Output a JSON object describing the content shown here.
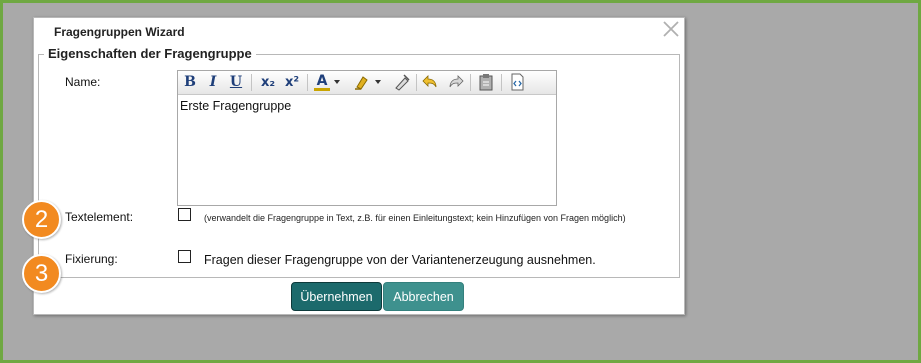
{
  "dialog": {
    "title": "Fragengruppen Wizard",
    "close_icon": "close-icon"
  },
  "fieldset": {
    "legend": "Eigenschaften der Fragengruppe"
  },
  "name_field": {
    "label": "Name:",
    "value": "Erste Fragengruppe"
  },
  "toolbar": {
    "bold": "B",
    "italic": "I",
    "underline": "U",
    "subscript": "x₂",
    "superscript": "x²",
    "font_color": "A",
    "icons": [
      "bold-icon",
      "italic-icon",
      "underline-icon",
      "subscript-icon",
      "superscript-icon",
      "font-color-icon",
      "highlight-icon",
      "clear-format-icon",
      "undo-icon",
      "redo-icon",
      "paste-icon",
      "source-icon"
    ]
  },
  "textelement": {
    "label": "Textelement:",
    "checked": false,
    "hint": "(verwandelt die Fragengruppe in Text, z.B. für einen Einleitungstext; kein Hinzufügen von Fragen möglich)"
  },
  "fixierung": {
    "label": "Fixierung:",
    "checked": false,
    "text": "Fragen dieser Fragengruppe von der Variantenerzeugung ausnehmen."
  },
  "buttons": {
    "apply": "Übernehmen",
    "cancel": "Abbrechen"
  },
  "badges": [
    "2",
    "3"
  ],
  "colors": {
    "frame_border": "#6fa842",
    "backdrop": "#a9a9a9",
    "primary_button": "#1c6a6c",
    "secondary_button": "#3e918e",
    "badge": "#f28a20"
  }
}
